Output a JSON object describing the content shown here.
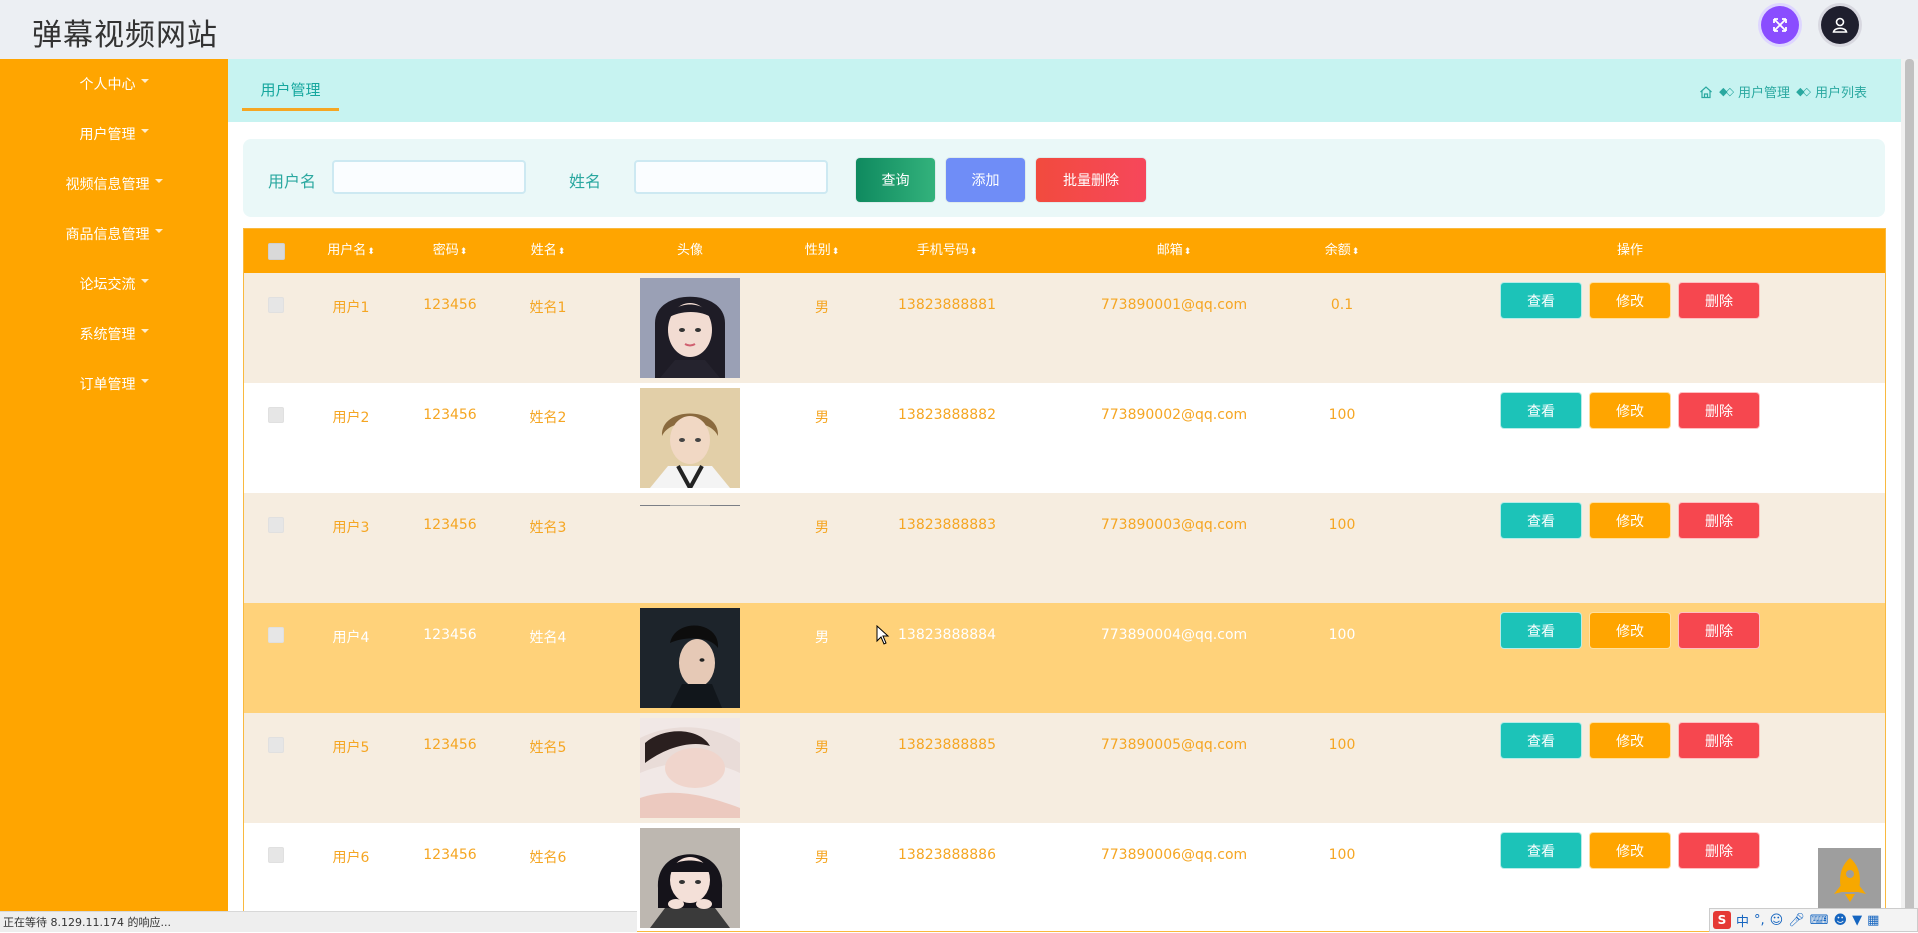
{
  "header": {
    "site_title": "弹幕视频网站",
    "expand_icon": "expand-arrows-icon",
    "user_icon": "user-icon"
  },
  "sidebar": {
    "items": [
      {
        "label": "个人中心"
      },
      {
        "label": "用户管理"
      },
      {
        "label": "视频信息管理"
      },
      {
        "label": "商品信息管理"
      },
      {
        "label": "论坛交流"
      },
      {
        "label": "系统管理"
      },
      {
        "label": "订单管理"
      }
    ]
  },
  "tabbar": {
    "active_tab": "用户管理",
    "breadcrumb": [
      "用户管理",
      "用户列表"
    ],
    "home_icon": "home-icon"
  },
  "search": {
    "username_label": "用户名",
    "username_value": "",
    "name_label": "姓名",
    "name_value": "",
    "query_btn": "查询",
    "add_btn": "添加",
    "batch_delete_btn": "批量删除"
  },
  "table": {
    "columns": [
      "用户名",
      "密码",
      "姓名",
      "头像",
      "性别",
      "手机号码",
      "邮箱",
      "余额",
      "操作"
    ],
    "actions": {
      "view": "查看",
      "edit": "修改",
      "delete": "删除"
    },
    "rows": [
      {
        "username": "用户1",
        "password": "123456",
        "name": "姓名1",
        "gender": "男",
        "phone": "13823888881",
        "email": "773890001@qq.com",
        "balance": "0.1"
      },
      {
        "username": "用户2",
        "password": "123456",
        "name": "姓名2",
        "gender": "男",
        "phone": "13823888882",
        "email": "773890002@qq.com",
        "balance": "100"
      },
      {
        "username": "用户3",
        "password": "123456",
        "name": "姓名3",
        "gender": "男",
        "phone": "13823888883",
        "email": "773890003@qq.com",
        "balance": "100"
      },
      {
        "username": "用户4",
        "password": "123456",
        "name": "姓名4",
        "gender": "男",
        "phone": "13823888884",
        "email": "773890004@qq.com",
        "balance": "100"
      },
      {
        "username": "用户5",
        "password": "123456",
        "name": "姓名5",
        "gender": "男",
        "phone": "13823888885",
        "email": "773890005@qq.com",
        "balance": "100"
      },
      {
        "username": "用户6",
        "password": "123456",
        "name": "姓名6",
        "gender": "男",
        "phone": "13823888886",
        "email": "773890006@qq.com",
        "balance": "100"
      }
    ]
  },
  "status_bar": {
    "text": "正在等待 8.129.11.174 的响应..."
  },
  "ime": {
    "mode": "中"
  },
  "colors": {
    "sidebar": "#ffa500",
    "tabbar": "#c7f3f1",
    "query_btn": "#1a9a6c",
    "add_btn": "#6f8df7",
    "delete_btn": "#f6474f",
    "view_btn": "#1cc3b8"
  }
}
